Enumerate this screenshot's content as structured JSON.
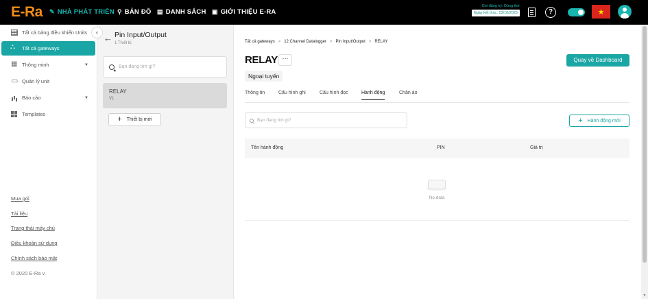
{
  "header": {
    "logo": "E-Ra",
    "nav": [
      {
        "label": "NHÀ PHÁT TRIỂN",
        "icon": "wrench-icon"
      },
      {
        "label": "BẢN ĐỒ",
        "icon": "map-pin-icon"
      },
      {
        "label": "DANH SÁCH",
        "icon": "list-icon"
      },
      {
        "label": "GIỚI THIỆU E-RA",
        "icon": "info-icon"
      }
    ],
    "subscription": "Gói đăng ký: Dùng thử",
    "expiry": "Ngày kết thúc: 23/10/2025",
    "accent": "#19b5b0"
  },
  "sidebar": {
    "items": [
      {
        "label": "Tất cả bảng điều khiển Units"
      },
      {
        "label": "Tất cả gateways"
      },
      {
        "label": "Thông minh"
      },
      {
        "label": "Quản lý unit"
      },
      {
        "label": "Báo cáo"
      },
      {
        "label": "Templates"
      }
    ],
    "footer": [
      "Mua gói",
      "Tài liệu",
      "Trạng thái máy chủ",
      "Điều khoản sử dụng",
      "Chính sách bảo mật"
    ],
    "copyright": "© 2020 E-Ra v"
  },
  "panel": {
    "title": "Pin Input/Output",
    "subtitle": "1 Thiết bị",
    "search_placeholder": "Bạn đang tìm gì?",
    "device": {
      "name": "RELAY",
      "version": "V1"
    },
    "new_device": "Thiết bị mới"
  },
  "main": {
    "breadcrumb": [
      "Tất cả gateways",
      "12 Channel Datalogger",
      "Pin Input/Output",
      "RELAY"
    ],
    "title": "RELAY",
    "more": "···",
    "status": "Ngoại tuyến",
    "dashboard_btn": "Quay về Dashboard",
    "tabs": [
      "Thông tin",
      "Cấu hình ghi",
      "Cấu hình đọc",
      "Hành động",
      "Chân ảo"
    ],
    "active_tab": "Hành động",
    "search_placeholder": "Bạn đang tìm gì?",
    "new_action": "Hành động mới",
    "columns": [
      "Tên hành động",
      "PIN",
      "Giá trị"
    ],
    "empty": "No data"
  }
}
